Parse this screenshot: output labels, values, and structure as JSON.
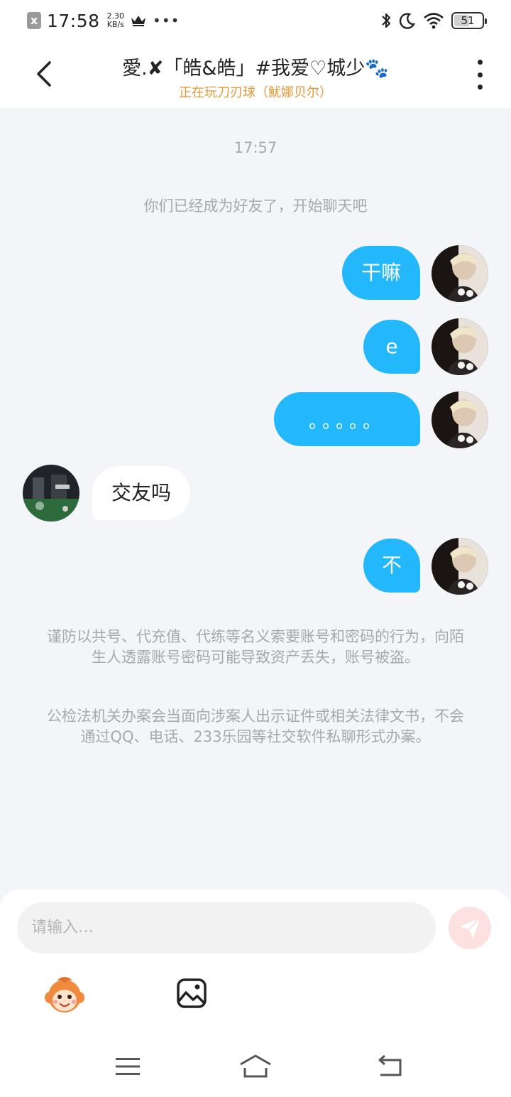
{
  "status_bar": {
    "time": "17:58",
    "net_speed_value": "2.30",
    "net_speed_unit": "KB/s",
    "more": "•••",
    "battery": "51",
    "notification_icon": "x"
  },
  "header": {
    "title": "愛.✘「皓&皓」#我爱♡城少🐾",
    "subtitle": "正在玩刀刃球（魷娜贝尔）"
  },
  "chat": {
    "time": "17:57",
    "system_message": "你们已经成为好友了，开始聊天吧",
    "messages": [
      {
        "side": "out",
        "text": "干嘛"
      },
      {
        "side": "out",
        "text": "e"
      },
      {
        "side": "out",
        "text": "。。。。。"
      },
      {
        "side": "in",
        "text": "交友吗"
      },
      {
        "side": "out",
        "text": "不"
      }
    ],
    "warnings": [
      "谨防以共号、代充值、代练等名义索要账号和密码的行为，向陌生人透露账号密码可能导致资产丢失，账号被盗。",
      "公检法机关办案会当面向涉案人出示证件或相关法律文书，不会通过QQ、电话、233乐园等社交软件私聊形式办案。"
    ]
  },
  "input": {
    "placeholder": "请输入…"
  },
  "colors": {
    "accent": "#23b7fb",
    "subtitle": "#e39a3b",
    "send_button": "#fde0e0"
  },
  "icons": {
    "back": "chevron-left-icon",
    "more": "more-vertical-icon",
    "send": "paper-plane-icon",
    "emoji": "monkey-face-icon",
    "image": "image-icon",
    "nav_menu": "menu-icon",
    "nav_home": "home-icon",
    "nav_back": "back-arrow-icon"
  }
}
